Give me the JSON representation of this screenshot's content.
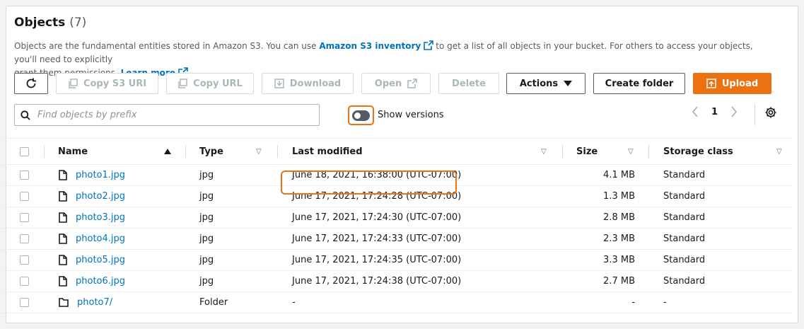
{
  "header": {
    "title": "Objects",
    "count": "(7)"
  },
  "description": {
    "part1": "Objects are the fundamental entities stored in Amazon S3. You can use",
    "inventory_link": "Amazon S3 inventory",
    "part2": "to get a list of all objects in your bucket. For others to access your objects, you'll need to explicitly",
    "part3": "grant them permissions.",
    "learn_more": "Learn more"
  },
  "toolbar": {
    "copy_s3_uri": "Copy S3 URI",
    "copy_url": "Copy URL",
    "download": "Download",
    "open": "Open",
    "delete": "Delete",
    "actions": "Actions",
    "create_folder": "Create folder",
    "upload": "Upload"
  },
  "search": {
    "placeholder": "Find objects by prefix"
  },
  "versions": {
    "label": "Show versions",
    "on": false
  },
  "pagination": {
    "page": "1"
  },
  "columns": {
    "name": "Name",
    "type": "Type",
    "last_modified": "Last modified",
    "size": "Size",
    "storage_class": "Storage class"
  },
  "rows": [
    {
      "name": "photo1.jpg",
      "type": "jpg",
      "modified": "June 18, 2021, 16:38:00 (UTC-07:00)",
      "size": "4.1 MB",
      "storage": "Standard",
      "kind": "file"
    },
    {
      "name": "photo2.jpg",
      "type": "jpg",
      "modified": "June 17, 2021, 17:24:28 (UTC-07:00)",
      "size": "1.3 MB",
      "storage": "Standard",
      "kind": "file"
    },
    {
      "name": "photo3.jpg",
      "type": "jpg",
      "modified": "June 17, 2021, 17:24:30 (UTC-07:00)",
      "size": "2.8 MB",
      "storage": "Standard",
      "kind": "file"
    },
    {
      "name": "photo4.jpg",
      "type": "jpg",
      "modified": "June 17, 2021, 17:24:33 (UTC-07:00)",
      "size": "2.3 MB",
      "storage": "Standard",
      "kind": "file"
    },
    {
      "name": "photo5.jpg",
      "type": "jpg",
      "modified": "June 17, 2021, 17:24:35 (UTC-07:00)",
      "size": "3.3 MB",
      "storage": "Standard",
      "kind": "file"
    },
    {
      "name": "photo6.jpg",
      "type": "jpg",
      "modified": "June 17, 2021, 17:24:38 (UTC-07:00)",
      "size": "2.7 MB",
      "storage": "Standard",
      "kind": "file"
    },
    {
      "name": "photo7/",
      "type": "Folder",
      "modified": "-",
      "size": "-",
      "storage": "-",
      "kind": "folder"
    }
  ],
  "colors": {
    "accent": "#ec7211",
    "link": "#0073bb"
  }
}
